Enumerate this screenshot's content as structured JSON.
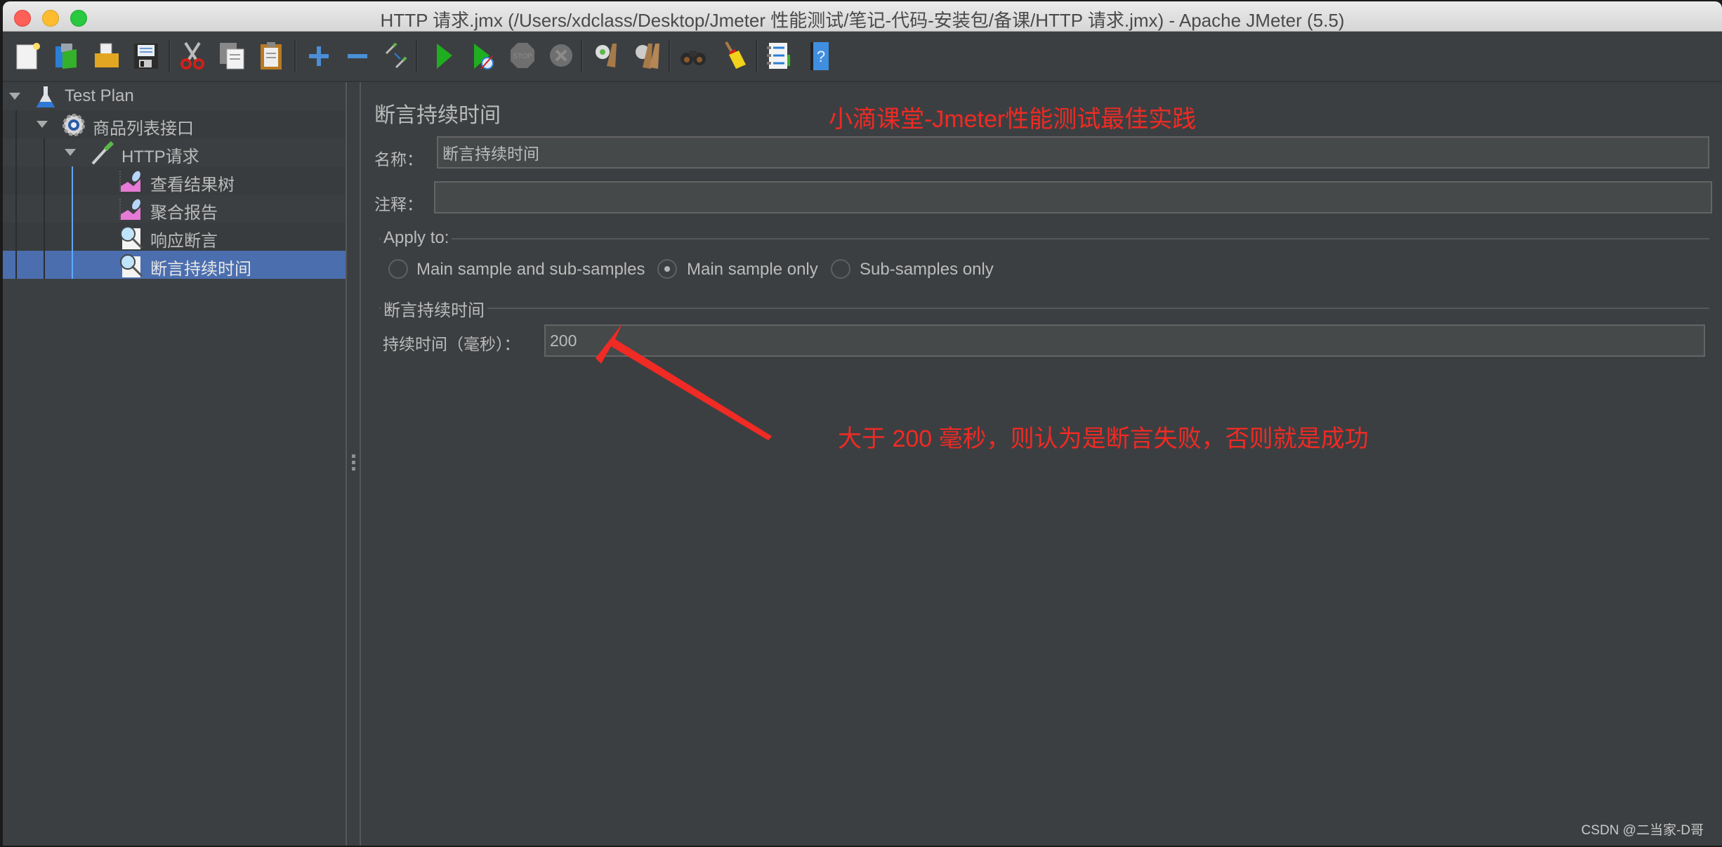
{
  "window": {
    "title": "HTTP 请求.jmx (/Users/xdclass/Desktop/Jmeter 性能测试/笔记-代码-安装包/备课/HTTP 请求.jmx) - Apache JMeter (5.5)"
  },
  "toolbar": {
    "buttons": [
      {
        "name": "new",
        "icon": "new-document-icon"
      },
      {
        "name": "templates",
        "icon": "templates-icon"
      },
      {
        "name": "open",
        "icon": "open-folder-icon"
      },
      {
        "name": "save",
        "icon": "save-disk-icon"
      },
      {
        "name": "cut",
        "icon": "scissors-icon"
      },
      {
        "name": "copy",
        "icon": "copy-icon"
      },
      {
        "name": "paste",
        "icon": "paste-clipboard-icon"
      },
      {
        "name": "expand",
        "icon": "plus-icon"
      },
      {
        "name": "collapse",
        "icon": "minus-icon"
      },
      {
        "name": "toggle",
        "icon": "toggle-pipette-icon"
      },
      {
        "name": "start",
        "icon": "play-icon"
      },
      {
        "name": "start-no-pauses",
        "icon": "play-no-timer-icon"
      },
      {
        "name": "stop",
        "icon": "stop-icon"
      },
      {
        "name": "shutdown",
        "icon": "shutdown-icon"
      },
      {
        "name": "clear",
        "icon": "clear-broom-gear-icon"
      },
      {
        "name": "clear-all",
        "icon": "clear-all-broom-icon"
      },
      {
        "name": "search",
        "icon": "binoculars-icon"
      },
      {
        "name": "reset-search",
        "icon": "broom-icon"
      },
      {
        "name": "function-helper",
        "icon": "function-list-icon"
      },
      {
        "name": "help",
        "icon": "help-book-icon"
      }
    ]
  },
  "tree": {
    "items": [
      {
        "label": "Test Plan",
        "icon": "flask-icon",
        "level": 0,
        "expanded": true
      },
      {
        "label": "商品列表接口",
        "icon": "thread-group-gear-icon",
        "level": 1,
        "expanded": true
      },
      {
        "label": "HTTP请求",
        "icon": "sampler-pipette-icon",
        "level": 2,
        "expanded": true
      },
      {
        "label": "查看结果树",
        "icon": "listener-graph-icon",
        "level": 3
      },
      {
        "label": "聚合报告",
        "icon": "listener-graph-icon",
        "level": 3
      },
      {
        "label": "响应断言",
        "icon": "assertion-magnifier-icon",
        "level": 3
      },
      {
        "label": "断言持续时间",
        "icon": "assertion-magnifier-icon",
        "level": 3,
        "selected": true
      }
    ]
  },
  "panel": {
    "title": "断言持续时间",
    "name_label": "名称：",
    "name_value": "断言持续时间",
    "comment_label": "注释：",
    "comment_value": "",
    "apply_to": {
      "title": "Apply to:",
      "options": [
        {
          "label": "Main sample and sub-samples",
          "checked": false
        },
        {
          "label": "Main sample only",
          "checked": true
        },
        {
          "label": "Sub-samples only",
          "checked": false
        }
      ]
    },
    "duration_section_title": "断言持续时间",
    "duration_label": "持续时间（毫秒）：",
    "duration_value": "200"
  },
  "annotations": {
    "header": "小滴课堂-Jmeter性能测试最佳实践",
    "note": "大于 200 毫秒，则认为是断言失败，否则就是成功",
    "color": "#f02a24"
  },
  "watermark": "CSDN @二当家-D哥",
  "colors": {
    "background": "#3c3f41",
    "selection": "#4b6eaf",
    "text": "#bbbbbb"
  }
}
